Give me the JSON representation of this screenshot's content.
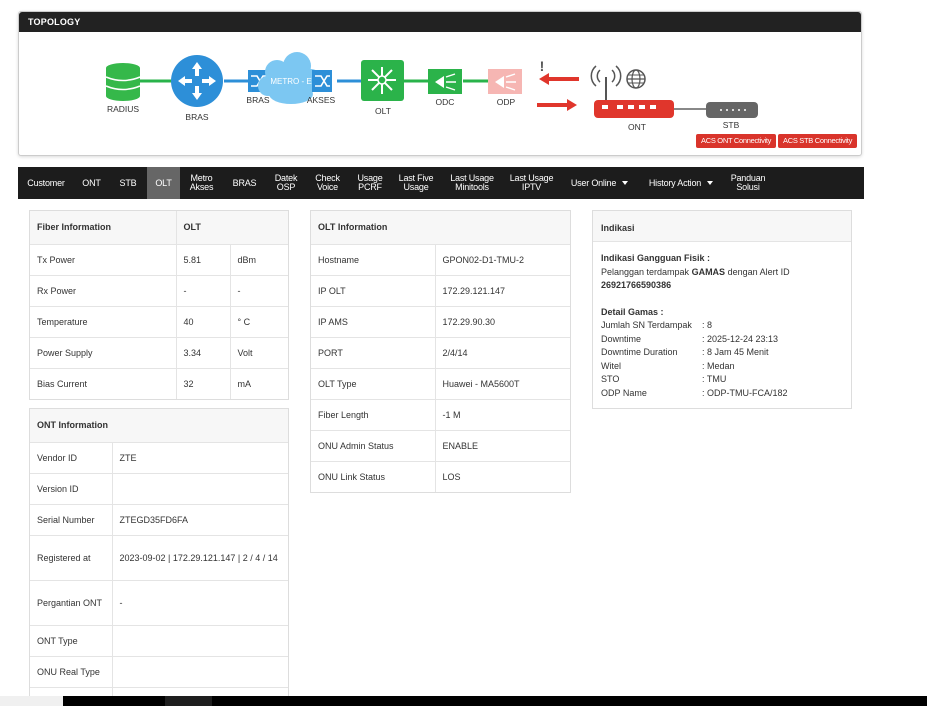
{
  "topology": {
    "title": "TOPOLOGY",
    "nodes": {
      "radius": "RADIUS",
      "bras_router": "BRAS",
      "bras_switch": "BRAS",
      "metro": "METRO - E",
      "akses": "AKSES",
      "olt": "OLT",
      "odc": "ODC",
      "odp": "ODP",
      "ont": "ONT",
      "stb": "STB"
    },
    "alert_mark": "!",
    "buttons": {
      "acs_ont": "ACS ONT Connectivity",
      "acs_stb": "ACS STB Connectivity"
    },
    "colors": {
      "link_green": "#29b34a",
      "router_blue": "#2d8fd8",
      "radius_green": "#35b84a",
      "olt_green": "#2bb34a",
      "odp_pink": "#f6b6b3",
      "alert_red": "#e0362c"
    }
  },
  "nav": {
    "items": [
      {
        "label": "Customer"
      },
      {
        "label": "ONT"
      },
      {
        "label": "STB"
      },
      {
        "label": "OLT",
        "active": true
      },
      {
        "label": "Metro\nAkses"
      },
      {
        "label": "BRAS"
      },
      {
        "label": "Datek\nOSP"
      },
      {
        "label": "Check\nVoice"
      },
      {
        "label": "Usage\nPCRF"
      },
      {
        "label": "Last Five\nUsage"
      },
      {
        "label": "Last Usage\nMinitools"
      },
      {
        "label": "Last Usage\nIPTV"
      },
      {
        "label": "User Online",
        "dropdown": true
      },
      {
        "label": "History Action",
        "dropdown": true
      },
      {
        "label": "Panduan\nSolusi"
      }
    ]
  },
  "fiber": {
    "headers": [
      "Fiber Information",
      "OLT"
    ],
    "rows": [
      [
        "Tx Power",
        "5.81",
        "dBm"
      ],
      [
        "Rx Power",
        "-",
        "-"
      ],
      [
        "Temperature",
        "40",
        "° C"
      ],
      [
        "Power Supply",
        "3.34",
        "Volt"
      ],
      [
        "Bias Current",
        "32",
        "mA"
      ]
    ]
  },
  "ont_info": {
    "header": "ONT Information",
    "rows": [
      [
        "Vendor ID",
        "ZTE"
      ],
      [
        "Version ID",
        ""
      ],
      [
        "Serial Number",
        "ZTEGD35FD6FA"
      ],
      [
        "Registered at",
        "2023-09-02 | 172.29.121.147 | 2 / 4 / 14"
      ],
      [
        "Pergantian ONT",
        "-"
      ],
      [
        "ONT Type",
        ""
      ],
      [
        "ONU Real Type",
        ""
      ]
    ]
  },
  "olt_info": {
    "header": "OLT Information",
    "rows": [
      [
        "Hostname",
        "GPON02-D1-TMU-2"
      ],
      [
        "IP OLT",
        "172.29.121.147"
      ],
      [
        "IP AMS",
        "172.29.90.30"
      ],
      [
        "PORT",
        "2/4/14"
      ],
      [
        "OLT Type",
        "Huawei - MA5600T"
      ],
      [
        "Fiber Length",
        "-1 M"
      ],
      [
        "ONU Admin Status",
        "ENABLE"
      ],
      [
        "ONU Link Status",
        "LOS"
      ]
    ]
  },
  "indikasi": {
    "header": "Indikasi",
    "gangguan_title": "Indikasi Gangguan Fisik :",
    "gangguan_text_1": "Pelanggan terdampak ",
    "gangguan_strong": "GAMAS",
    "gangguan_text_2": " dengan Alert ID",
    "alert_id": "26921766590386",
    "detail_title": "Detail Gamas :",
    "details": [
      [
        "Jumlah SN Terdampak",
        ": 8"
      ],
      [
        "Downtime",
        ": 2025-12-24 23:13"
      ],
      [
        "Downtime Duration",
        ": 8 Jam 45 Menit"
      ],
      [
        "Witel",
        ": Medan"
      ],
      [
        "STO",
        ": TMU"
      ],
      [
        "ODP Name",
        ": ODP-TMU-FCA/182"
      ]
    ]
  }
}
